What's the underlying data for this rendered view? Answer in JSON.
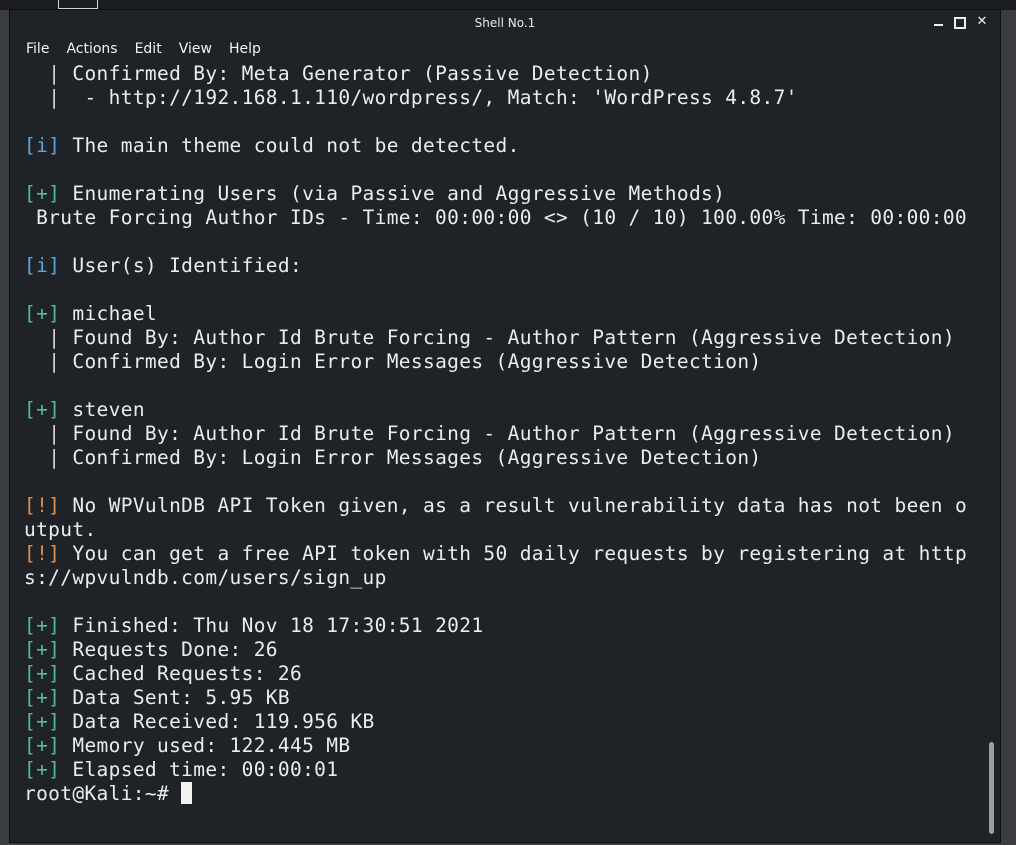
{
  "window": {
    "title": "Shell No.1",
    "controls": {
      "minimize": "minimize",
      "maximize": "maximize",
      "close": "✕"
    }
  },
  "menu": [
    "File",
    "Actions",
    "Edit",
    "View",
    "Help"
  ],
  "terminal": {
    "lines": [
      [
        "  ",
        "|",
        " Confirmed By: Meta Generator (Passive Detection)"
      ],
      [
        "  ",
        "|",
        "  - http://192.168.1.110/wordpress/, Match: 'WordPress 4.8.7'"
      ],
      [
        ""
      ],
      [
        "[i]",
        " The main theme could not be detected."
      ],
      [
        ""
      ],
      [
        "[+]",
        " Enumerating Users (via Passive and Aggressive Methods)"
      ],
      [
        " Brute Forcing Author IDs - Time: 00:00:00 <> (10 / 10) 100.00% Time: 00:00:00"
      ],
      [
        ""
      ],
      [
        "[i]",
        " User(s) Identified:"
      ],
      [
        ""
      ],
      [
        "[+]",
        " michael"
      ],
      [
        "  ",
        "|",
        " Found By: Author Id Brute Forcing - Author Pattern (Aggressive Detection)"
      ],
      [
        "  ",
        "|",
        " Confirmed By: Login Error Messages (Aggressive Detection)"
      ],
      [
        ""
      ],
      [
        "[+]",
        " steven"
      ],
      [
        "  ",
        "|",
        " Found By: Author Id Brute Forcing - Author Pattern (Aggressive Detection)"
      ],
      [
        "  ",
        "|",
        " Confirmed By: Login Error Messages (Aggressive Detection)"
      ],
      [
        ""
      ],
      [
        "[!]",
        " No WPVulnDB API Token given, as a result vulnerability data has not been o"
      ],
      [
        "utput."
      ],
      [
        "[!]",
        " You can get a free API token with 50 daily requests by registering at http"
      ],
      [
        "s://wpvulndb.com/users/sign_up"
      ],
      [
        ""
      ],
      [
        "[+]",
        " Finished: Thu Nov 18 17:30:51 2021"
      ],
      [
        "[+]",
        " Requests Done: 26"
      ],
      [
        "[+]",
        " Cached Requests: 26"
      ],
      [
        "[+]",
        " Data Sent: 5.95 KB"
      ],
      [
        "[+]",
        " Data Received: 119.956 KB"
      ],
      [
        "[+]",
        " Memory used: 122.445 MB"
      ],
      [
        "[+]",
        " Elapsed time: 00:00:01"
      ]
    ],
    "prompt": "root@Kali:~# "
  },
  "colors": {
    "info": "#5ea4d8",
    "plus": "#57b89a",
    "warn": "#e0904a",
    "background": "#1f2327",
    "text": "#ececec"
  }
}
